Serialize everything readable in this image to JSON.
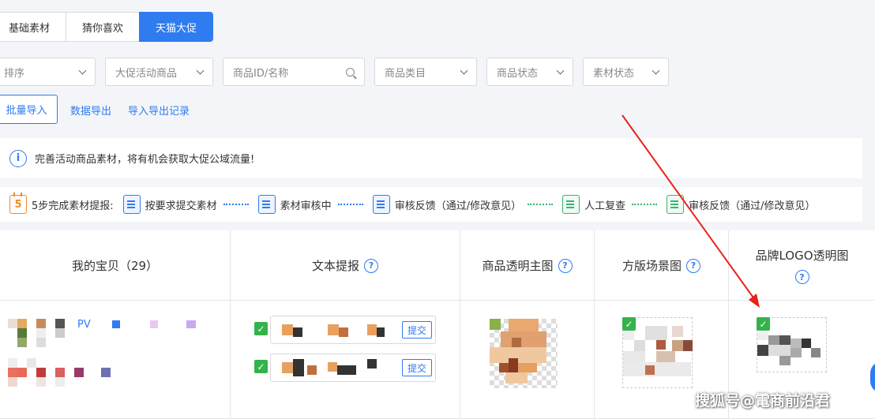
{
  "tabs": [
    {
      "label": "基础素材",
      "active": false
    },
    {
      "label": "猜你喜欢",
      "active": false
    },
    {
      "label": "天猫大促",
      "active": true
    }
  ],
  "filters": {
    "sort": "排序",
    "promo_goods": "大促活动商品",
    "search_placeholder": "商品ID/名称",
    "category": "商品类目",
    "goods_status": "商品状态",
    "material_status": "素材状态"
  },
  "actions": {
    "batch_import": "批量导入",
    "data_export": "数据导出",
    "import_export_log": "导入导出记录"
  },
  "notice": {
    "icon": "info-icon",
    "text": "完善活动商品素材，将有机会获取大促公域流量!"
  },
  "steps": {
    "calendar_digit": "5",
    "intro": "5步完成素材提报:",
    "items": [
      "按要求提交素材",
      "素材审核中",
      "审核反馈（通过/修改意见）",
      "人工复查",
      "审核反馈（通过/修改意见）"
    ]
  },
  "table": {
    "headers": [
      "我的宝贝（29）",
      "文本提报",
      "商品透明主图",
      "方版场景图",
      "品牌LOGO透明图"
    ],
    "help_glyph": "?",
    "row": {
      "product_prefix": "PV",
      "submit_label": "提交",
      "check_glyph": "✓"
    }
  },
  "colors": {
    "primary": "#2f7bf0",
    "success": "#34b34a",
    "annotation_arrow": "#e8231a"
  },
  "watermark": "搜狐号@電商前沿君"
}
